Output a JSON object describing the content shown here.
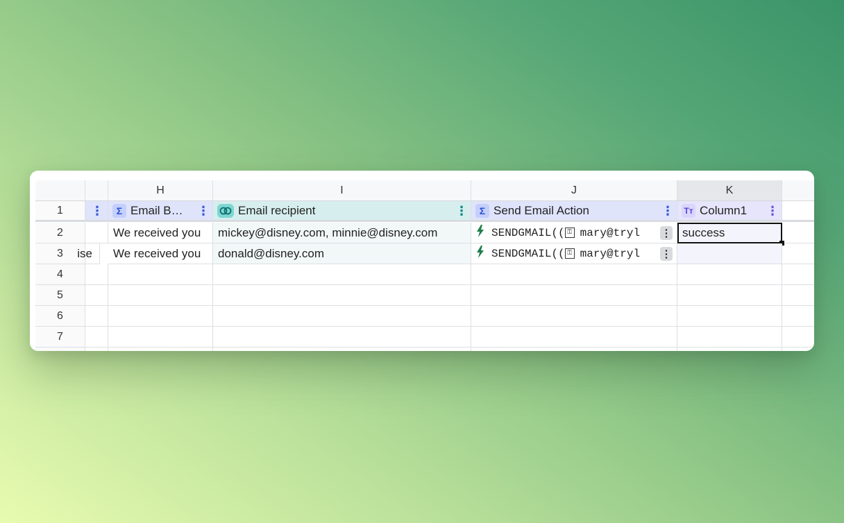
{
  "columns": {
    "g": "",
    "h": "H",
    "i": "I",
    "j": "J",
    "k": "K",
    "l": ""
  },
  "fields": {
    "h": {
      "label": "Email B…",
      "kebab": "⋮"
    },
    "i": {
      "label": "Email recipient",
      "kebab": "⋮"
    },
    "j": {
      "label": "Send Email Action",
      "kebab": "⋮"
    },
    "k": {
      "label": "Column1",
      "kebab": "⋮"
    },
    "g": {
      "kebab": "⋮"
    },
    "icons": {
      "sigma": "Σ",
      "link": "⊂⊃",
      "text": "Tт"
    }
  },
  "row_numbers": [
    "1",
    "2",
    "3",
    "4",
    "5",
    "6",
    "7"
  ],
  "rows": [
    {
      "g": "",
      "h": "We received you",
      "i": "mickey@disney.com, minnie@disney.com",
      "j": "SENDGMAIL((",
      "j_key": "⚿",
      "j_rest": "mary@tryl",
      "k": "success"
    },
    {
      "g": "ise",
      "h": "We received you",
      "i": "donald@disney.com",
      "j": "SENDGMAIL((",
      "j_key": "⚿",
      "j_rest": "mary@tryl",
      "k": ""
    }
  ],
  "action_menu": "⋮",
  "selected_cell": "K2"
}
